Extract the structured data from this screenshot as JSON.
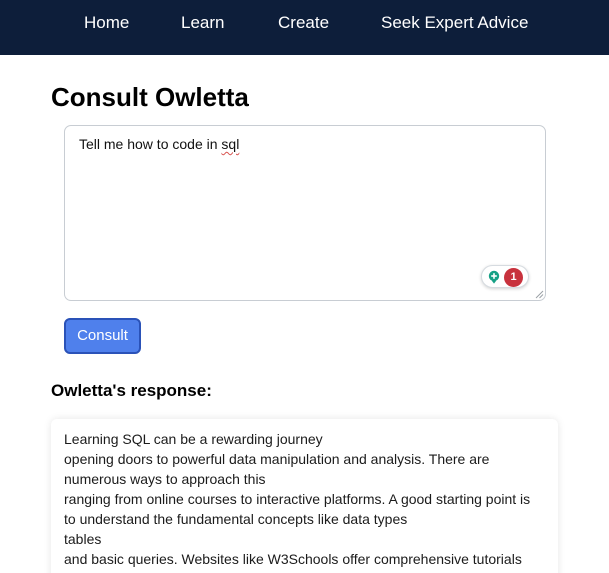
{
  "nav": {
    "home": "Home",
    "learn": "Learn",
    "create": "Create",
    "seek_advice": "Seek Expert Advice"
  },
  "page": {
    "title": "Consult Owletta"
  },
  "prompt": {
    "value_prefix": "Tell me how to code in ",
    "value_misspelled": "sql",
    "grammar_issue_count": "1"
  },
  "consult_button": {
    "label": "Consult"
  },
  "response": {
    "heading": "Owletta's response:",
    "lines": [
      "Learning SQL can be a rewarding journey",
      "opening doors to powerful data manipulation and analysis. There are",
      "numerous ways to approach this",
      "ranging from online courses to interactive platforms. A good starting point is",
      "to understand the fundamental concepts like data types",
      "tables",
      "and basic queries. Websites like W3Schools offer comprehensive tutorials"
    ]
  },
  "colors": {
    "nav_bg": "#0d1e3a",
    "button_bg": "#4f80ec",
    "button_border": "#2a52b8",
    "badge_red": "#c8323d",
    "grammar_green": "#16a085"
  },
  "icons": {
    "grammar": "grammar-assistant-icon",
    "resize": "resize-grip-icon"
  }
}
